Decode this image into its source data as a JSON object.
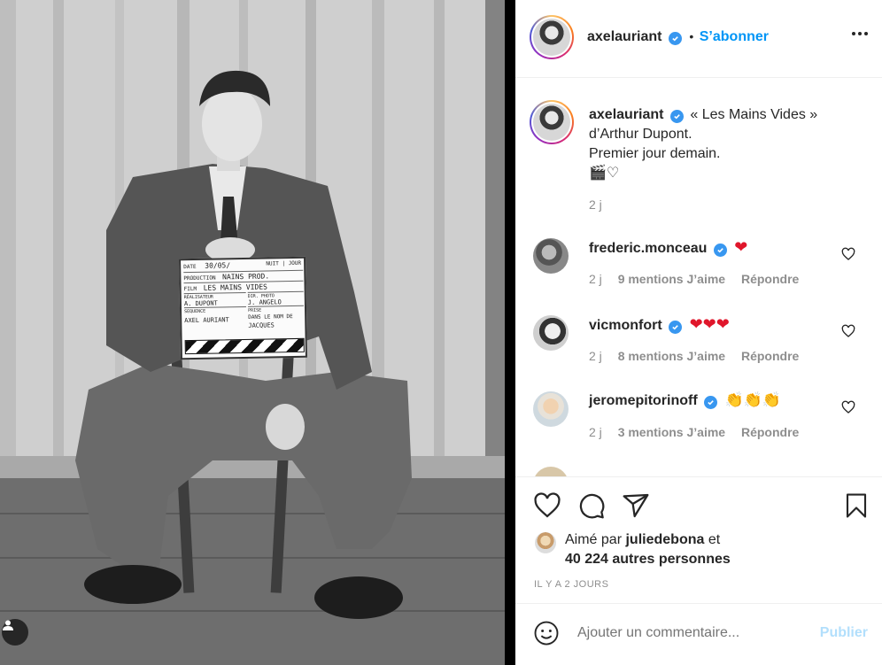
{
  "post": {
    "author": "axelauriant",
    "follow_label": "S’abonner",
    "bullet": "•",
    "caption_lines": [
      "« Les Mains Vides »",
      "d’Arthur Dupont.",
      "Premier jour demain.",
      "🎬♡"
    ],
    "caption_time": "2 j",
    "clapperboard": {
      "date_label": "DATE",
      "date_value": "30/05/",
      "nuit_jour": "NUIT | JOUR",
      "production_label": "PRODUCTION",
      "production_value": "NAINS PROD.",
      "film_label": "FILM",
      "film_value": "LES MAINS VIDES",
      "realisateur_label": "RÉALISATEUR",
      "realisateur_value": "A. DUPONT",
      "photo_label": "DIR. PHOTO",
      "photo_value": "J. ANGELO",
      "sequence_label": "SEQUENCE",
      "sequence_value": "AXEL AURIANT",
      "prise_label": "PRISE",
      "prise_value": "DANS LE NOM DE",
      "prise_value2": "JACQUES"
    }
  },
  "comments": [
    {
      "user": "frederic.monceau",
      "text": "❤",
      "time": "2 j",
      "likes": "9 mentions J’aime",
      "reply": "Répondre"
    },
    {
      "user": "vicmonfort",
      "text": "❤❤❤",
      "time": "2 j",
      "likes": "8 mentions J’aime",
      "reply": "Répondre"
    },
    {
      "user": "jeromepitorinoff",
      "text": "👏👏👏",
      "time": "2 j",
      "likes": "3 mentions J’aime",
      "reply": "Répondre"
    }
  ],
  "likes": {
    "prefix": "Aimé par",
    "user": "juliedebona",
    "and": "et",
    "others": "40 224 autres personnes"
  },
  "timestamp": "IL Y A 2 JOURS",
  "add_comment": {
    "placeholder": "Ajouter un commentaire...",
    "post_label": "Publier"
  },
  "colors": {
    "accent": "#0095f6",
    "verified": "#3897f0",
    "heart": "#e0162b",
    "muted": "#8e8e8e",
    "post_disabled": "#b2dffc"
  },
  "icons": {
    "like": "heart-outline-icon",
    "comment": "speech-bubble-icon",
    "share": "paper-plane-icon",
    "save": "bookmark-icon",
    "more": "more-dots-icon",
    "emoji": "smiley-icon",
    "tag": "person-tag-icon",
    "verified": "verified-badge-icon"
  }
}
